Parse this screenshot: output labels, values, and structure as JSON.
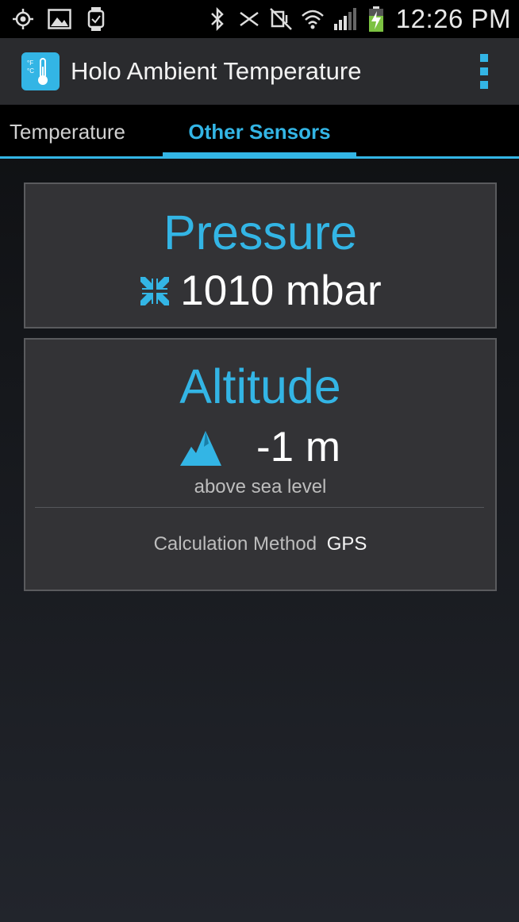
{
  "status_bar": {
    "time": "12:26 PM",
    "icons": [
      "gps-icon",
      "gallery-icon",
      "watch-icon",
      "bluetooth-icon",
      "nfc-icon",
      "mute-icon",
      "wifi-icon",
      "signal-icon",
      "battery-charging-icon"
    ]
  },
  "action_bar": {
    "title": "Holo Ambient Temperature",
    "app_icon": "thermometer-icon",
    "overflow_icon": "overflow-menu-icon"
  },
  "tabs": [
    {
      "label": "Temperature",
      "selected": false
    },
    {
      "label": "Other Sensors",
      "selected": true
    }
  ],
  "pressure": {
    "title": "Pressure",
    "value": "1010 mbar",
    "icon": "pressure-icon"
  },
  "altitude": {
    "title": "Altitude",
    "value": "-1 m",
    "icon": "mountain-icon",
    "subtitle": "above sea level",
    "method_label": "Calculation Method",
    "method_value": "GPS"
  },
  "colors": {
    "accent": "#33b5e5",
    "card_bg": "#333336",
    "action_bar_bg": "#2a2b2e"
  }
}
